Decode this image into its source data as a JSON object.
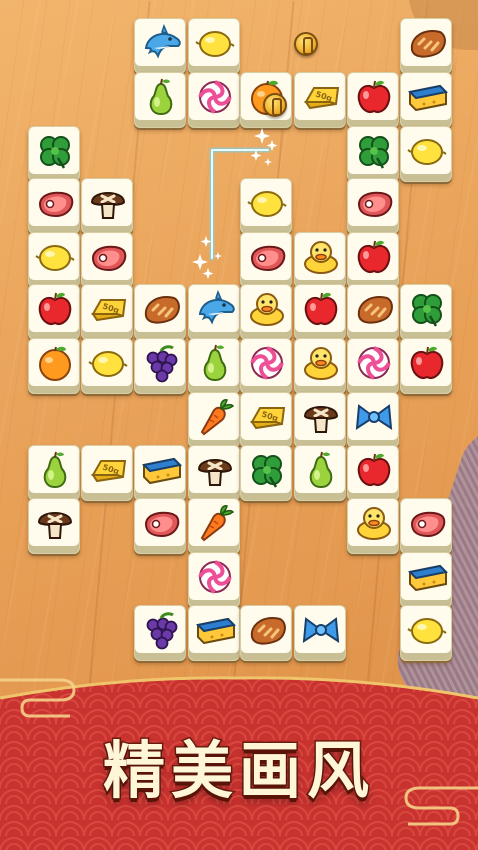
{
  "banner": {
    "title": "精美画风"
  },
  "colors": {
    "tile_face": "#fffcee",
    "tile_edge": "#c9bf94",
    "banner_red": "#c8322f",
    "link_line": "#a9ecff"
  },
  "grid": {
    "rows": [
      [
        "",
        "",
        "dolphin",
        "lemon",
        "",
        "",
        "",
        "bread"
      ],
      [
        "",
        "",
        "pear",
        "candy",
        "orange",
        "gold",
        "apple",
        "sponge"
      ],
      [
        "clover",
        "",
        "",
        "",
        "",
        "",
        "clover",
        "lemon"
      ],
      [
        "steak",
        "mushroom",
        "",
        "",
        "lemon",
        "",
        "steak",
        ""
      ],
      [
        "lemon",
        "steak",
        "",
        "",
        "steak",
        "duck",
        "apple",
        ""
      ],
      [
        "apple",
        "gold",
        "bread",
        "dolphin",
        "duck",
        "apple",
        "bread",
        "clover"
      ],
      [
        "orange",
        "lemon",
        "grapes",
        "pear",
        "candy",
        "duck",
        "candy",
        "apple"
      ],
      [
        "",
        "",
        "",
        "carrot",
        "gold",
        "mushroom",
        "bow",
        ""
      ],
      [
        "pear",
        "gold",
        "sponge",
        "mushroom",
        "clover",
        "pear",
        "apple",
        ""
      ],
      [
        "mushroom",
        "",
        "steak",
        "carrot",
        "",
        "",
        "duck",
        "steak"
      ],
      [
        "",
        "",
        "",
        "candy",
        "",
        "",
        "",
        "sponge"
      ],
      [
        "",
        "",
        "grapes",
        "sponge",
        "bread",
        "bow",
        "",
        "lemon"
      ]
    ]
  },
  "gold_label": "50g"
}
